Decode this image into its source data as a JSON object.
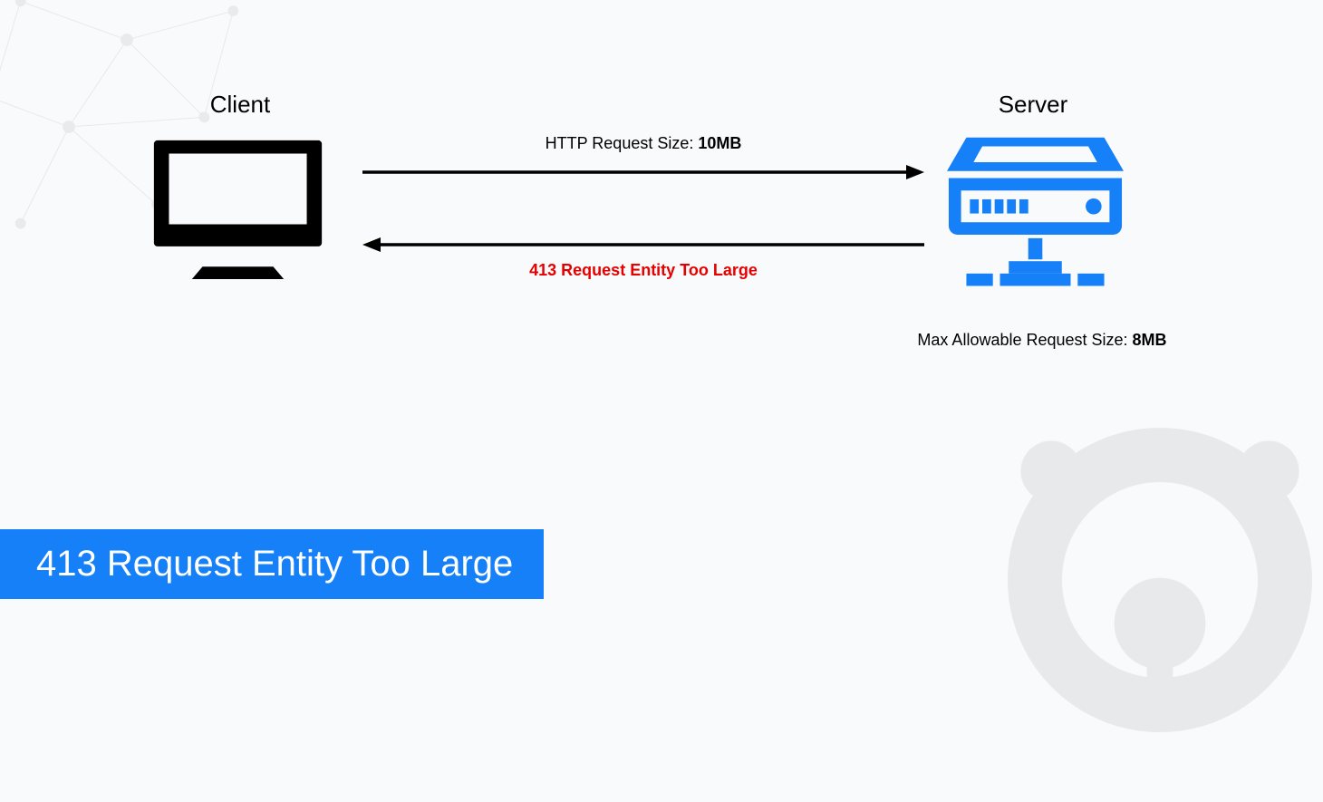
{
  "labels": {
    "client": "Client",
    "server": "Server"
  },
  "arrows": {
    "request_prefix": "HTTP Request Size: ",
    "request_size": "10MB",
    "response_text": "413 Request Entity Too Large"
  },
  "server_note": {
    "prefix": "Max Allowable Request Size: ",
    "value": "8MB"
  },
  "banner": {
    "title": "413 Request Entity Too Large"
  },
  "colors": {
    "accent_blue": "#1580f8",
    "error_red": "#e60000",
    "black": "#000000"
  }
}
